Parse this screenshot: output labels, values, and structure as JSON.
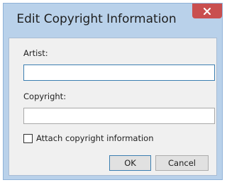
{
  "dialog": {
    "title": "Edit Copyright Information",
    "artist_label": "Artist:",
    "artist_value": "",
    "copyright_label": "Copyright:",
    "copyright_value": "",
    "attach_label": "Attach copyright information",
    "attach_checked": false,
    "ok_label": "OK",
    "cancel_label": "Cancel"
  },
  "colors": {
    "frame": "#b9d1ea",
    "close_button": "#c94f4f",
    "client_background": "#f0f0f0",
    "focus_border": "#3c7fb1"
  },
  "icons": {
    "close": "close-icon"
  }
}
